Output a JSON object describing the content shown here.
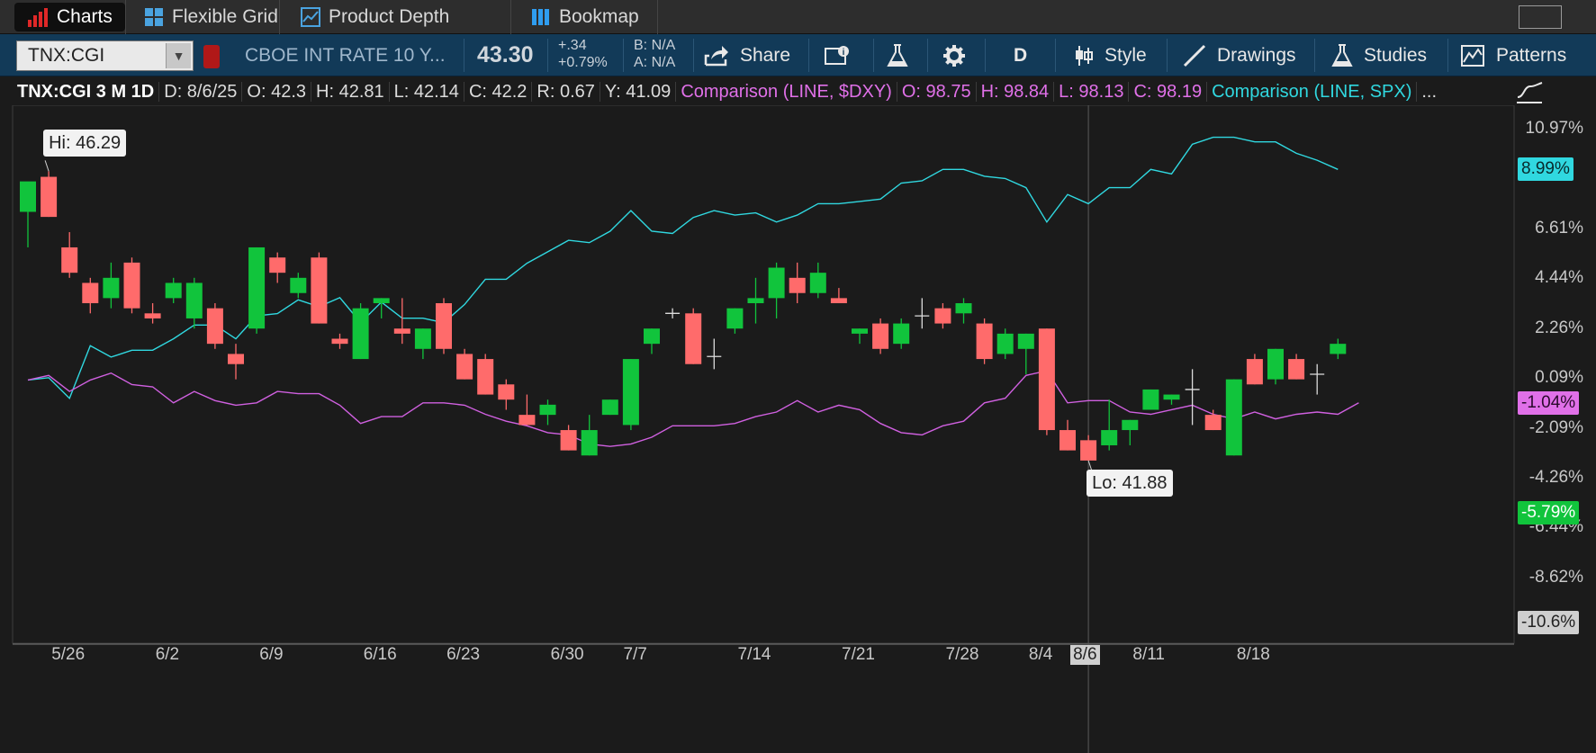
{
  "tabs": [
    {
      "label": "Charts",
      "icon": "bar-chart-icon"
    },
    {
      "label": "Flexible Grid",
      "icon": "grid-icon"
    },
    {
      "label": "Product Depth",
      "icon": "depth-chart-icon"
    },
    {
      "label": "Bookmap",
      "icon": "bookmap-icon"
    }
  ],
  "toolbar": {
    "symbol": "TNX:CGI",
    "description": "CBOE INT RATE 10 Y...",
    "last": "43.30",
    "change": "+.34",
    "change_pct": "+0.79%",
    "bid": "B: N/A",
    "ask": "A: N/A",
    "share": "Share",
    "timeframe": "D",
    "style": "Style",
    "drawings": "Drawings",
    "studies": "Studies",
    "patterns": "Patterns"
  },
  "info": {
    "symbol": "TNX:CGI 3 M 1D",
    "date": "D: 8/6/25",
    "open": "O: 42.3",
    "high": "H: 42.81",
    "low": "L: 42.14",
    "close": "C: 42.2",
    "range": "R: 0.67",
    "prev": "Y: 41.09",
    "cmp1": "Comparison (LINE, $DXY)",
    "cmp1_o": "O: 98.75",
    "cmp1_h": "H: 98.84",
    "cmp1_l": "L: 98.13",
    "cmp1_c": "C: 98.19",
    "cmp2": "Comparison (LINE, SPX)",
    "more": "..."
  },
  "colors": {
    "up": "#11c43c",
    "down": "#ff6b6b",
    "spx": "#30d8e0",
    "dxy": "#d060e0",
    "background": "#1b1b1b"
  },
  "chart_data": {
    "type": "candlestick",
    "ylabel_unit": "%",
    "ylim_pct": [
      -11.5,
      12.0
    ],
    "ylim_price": [
      37.1,
      47.7
    ],
    "right_axis_ticks": [
      "10.97%",
      "6.61%",
      "4.44%",
      "2.26%",
      "0.09%",
      "-2.09%",
      "-4.26%",
      "-6.44%",
      "-8.62%"
    ],
    "x_ticks": [
      "5/26",
      "6/2",
      "6/9",
      "6/16",
      "6/23",
      "6/30",
      "7/7",
      "7/14",
      "7/21",
      "7/28",
      "8/4",
      "8/6",
      "8/11",
      "8/18"
    ],
    "x_tick_positions": [
      2,
      7,
      12,
      17,
      21,
      26,
      29.5,
      35,
      40,
      45,
      49,
      51,
      54,
      59
    ],
    "crosshair_index": 51,
    "hi_label": "Hi: 46.29",
    "lo_label": "Lo: 41.88",
    "tags": {
      "spx": "8.99%",
      "dxy": "-1.04%",
      "last": "-5.79%",
      "bottom": "-10.6%"
    },
    "candles": [
      {
        "o": 45.6,
        "h": 46.1,
        "l": 44.9,
        "c": 46.2
      },
      {
        "o": 46.29,
        "h": 46.4,
        "l": 45.5,
        "c": 45.5
      },
      {
        "o": 44.9,
        "h": 45.2,
        "l": 44.3,
        "c": 44.4
      },
      {
        "o": 44.2,
        "h": 44.3,
        "l": 43.6,
        "c": 43.8
      },
      {
        "o": 43.9,
        "h": 44.6,
        "l": 43.7,
        "c": 44.3
      },
      {
        "o": 44.6,
        "h": 44.7,
        "l": 43.6,
        "c": 43.7
      },
      {
        "o": 43.6,
        "h": 43.8,
        "l": 43.4,
        "c": 43.5
      },
      {
        "o": 43.9,
        "h": 44.3,
        "l": 43.8,
        "c": 44.2
      },
      {
        "o": 43.5,
        "h": 44.3,
        "l": 43.3,
        "c": 44.2
      },
      {
        "o": 43.7,
        "h": 43.8,
        "l": 42.9,
        "c": 43.0
      },
      {
        "o": 42.8,
        "h": 43.0,
        "l": 42.3,
        "c": 42.6
      },
      {
        "o": 43.3,
        "h": 44.9,
        "l": 43.2,
        "c": 44.9
      },
      {
        "o": 44.7,
        "h": 44.8,
        "l": 44.2,
        "c": 44.4
      },
      {
        "o": 44.0,
        "h": 44.4,
        "l": 43.9,
        "c": 44.3
      },
      {
        "o": 44.7,
        "h": 44.8,
        "l": 43.4,
        "c": 43.4
      },
      {
        "o": 43.1,
        "h": 43.2,
        "l": 42.9,
        "c": 43.0
      },
      {
        "o": 42.7,
        "h": 43.8,
        "l": 42.7,
        "c": 43.7
      },
      {
        "o": 43.8,
        "h": 43.9,
        "l": 43.5,
        "c": 43.9
      },
      {
        "o": 43.3,
        "h": 43.9,
        "l": 43.0,
        "c": 43.2
      },
      {
        "o": 42.9,
        "h": 43.3,
        "l": 42.7,
        "c": 43.3
      },
      {
        "o": 43.8,
        "h": 43.9,
        "l": 42.8,
        "c": 42.9
      },
      {
        "o": 42.8,
        "h": 42.9,
        "l": 42.3,
        "c": 42.3
      },
      {
        "o": 42.7,
        "h": 42.8,
        "l": 42.0,
        "c": 42.0
      },
      {
        "o": 42.2,
        "h": 42.3,
        "l": 41.7,
        "c": 41.9
      },
      {
        "o": 41.6,
        "h": 42.0,
        "l": 41.4,
        "c": 41.4
      },
      {
        "o": 41.6,
        "h": 41.9,
        "l": 41.4,
        "c": 41.8
      },
      {
        "o": 41.3,
        "h": 41.4,
        "l": 40.9,
        "c": 40.9
      },
      {
        "o": 40.8,
        "h": 41.6,
        "l": 40.8,
        "c": 41.3
      },
      {
        "o": 41.6,
        "h": 41.9,
        "l": 41.6,
        "c": 41.9
      },
      {
        "o": 41.4,
        "h": 42.7,
        "l": 41.3,
        "c": 42.7
      },
      {
        "o": 43.0,
        "h": 43.3,
        "l": 42.8,
        "c": 43.3
      },
      {
        "o": 43.6,
        "h": 43.7,
        "l": 43.5,
        "c": 43.6
      },
      {
        "o": 43.6,
        "h": 43.7,
        "l": 42.6,
        "c": 42.6
      },
      {
        "o": 42.75,
        "h": 43.1,
        "l": 42.5,
        "c": 42.7
      },
      {
        "o": 43.3,
        "h": 43.7,
        "l": 43.2,
        "c": 43.7
      },
      {
        "o": 43.8,
        "h": 44.3,
        "l": 43.4,
        "c": 43.9
      },
      {
        "o": 43.9,
        "h": 44.6,
        "l": 43.5,
        "c": 44.5
      },
      {
        "o": 44.3,
        "h": 44.6,
        "l": 43.8,
        "c": 44.0
      },
      {
        "o": 44.0,
        "h": 44.6,
        "l": 43.9,
        "c": 44.4
      },
      {
        "o": 43.9,
        "h": 44.1,
        "l": 43.8,
        "c": 43.8
      },
      {
        "o": 43.2,
        "h": 43.3,
        "l": 43.0,
        "c": 43.3
      },
      {
        "o": 43.4,
        "h": 43.5,
        "l": 42.8,
        "c": 42.9
      },
      {
        "o": 43.0,
        "h": 43.5,
        "l": 42.9,
        "c": 43.4
      },
      {
        "o": 43.55,
        "h": 43.9,
        "l": 43.3,
        "c": 43.6
      },
      {
        "o": 43.7,
        "h": 43.8,
        "l": 43.3,
        "c": 43.4
      },
      {
        "o": 43.6,
        "h": 43.9,
        "l": 43.4,
        "c": 43.8
      },
      {
        "o": 43.4,
        "h": 43.5,
        "l": 42.6,
        "c": 42.7
      },
      {
        "o": 42.8,
        "h": 43.3,
        "l": 42.7,
        "c": 43.2
      },
      {
        "o": 42.9,
        "h": 43.2,
        "l": 42.4,
        "c": 43.2
      },
      {
        "o": 43.3,
        "h": 43.3,
        "l": 41.2,
        "c": 41.3
      },
      {
        "o": 41.3,
        "h": 41.5,
        "l": 40.9,
        "c": 40.9
      },
      {
        "o": 41.1,
        "h": 41.2,
        "l": 40.7,
        "c": 40.7
      },
      {
        "o": 41.0,
        "h": 41.9,
        "l": 40.9,
        "c": 41.3
      },
      {
        "o": 41.3,
        "h": 41.5,
        "l": 41.0,
        "c": 41.5
      },
      {
        "o": 41.7,
        "h": 42.1,
        "l": 41.7,
        "c": 42.1
      },
      {
        "o": 41.9,
        "h": 42.0,
        "l": 41.8,
        "c": 42.0
      },
      {
        "o": 42.1,
        "h": 42.5,
        "l": 41.4,
        "c": 42.1
      },
      {
        "o": 41.6,
        "h": 41.7,
        "l": 41.3,
        "c": 41.3
      },
      {
        "o": 40.8,
        "h": 42.3,
        "l": 40.8,
        "c": 42.3
      },
      {
        "o": 42.7,
        "h": 42.8,
        "l": 42.2,
        "c": 42.2
      },
      {
        "o": 42.3,
        "h": 42.9,
        "l": 42.2,
        "c": 42.9
      },
      {
        "o": 42.7,
        "h": 42.8,
        "l": 42.3,
        "c": 42.3
      },
      {
        "o": 42.4,
        "h": 42.6,
        "l": 42.0,
        "c": 42.4
      },
      {
        "o": 42.8,
        "h": 43.1,
        "l": 42.7,
        "c": 43.0
      }
    ],
    "series": [
      {
        "name": "SPX",
        "pct": [
          0.0,
          0.1,
          -0.8,
          1.5,
          1.0,
          1.3,
          1.3,
          1.8,
          2.4,
          2.4,
          1.8,
          2.8,
          2.9,
          3.5,
          3.2,
          3.6,
          2.5,
          3.4,
          2.7,
          2.7,
          2.5,
          3.3,
          4.4,
          4.4,
          5.1,
          5.6,
          6.1,
          6.0,
          6.5,
          7.4,
          6.5,
          6.4,
          7.1,
          7.4,
          7.2,
          7.3,
          6.9,
          7.2,
          7.7,
          7.7,
          7.8,
          7.9,
          8.6,
          8.7,
          9.2,
          9.2,
          8.9,
          8.8,
          8.4,
          6.9,
          8.1,
          7.7,
          8.4,
          8.4,
          9.2,
          9.0,
          10.3,
          10.6,
          10.6,
          10.4,
          10.4,
          9.9,
          9.6,
          9.2
        ]
      },
      {
        "name": "$DXY",
        "pct": [
          0.0,
          0.2,
          -0.5,
          0.0,
          0.3,
          -0.2,
          -0.3,
          -1.0,
          -0.5,
          -0.9,
          -1.1,
          -1.0,
          -0.5,
          -0.6,
          -0.6,
          -1.1,
          -1.9,
          -1.6,
          -1.6,
          -1.0,
          -1.0,
          -1.1,
          -1.5,
          -1.8,
          -2.0,
          -2.3,
          -2.4,
          -2.8,
          -2.9,
          -2.8,
          -2.5,
          -2.0,
          -2.0,
          -2.0,
          -1.9,
          -1.6,
          -1.4,
          -0.9,
          -1.4,
          -1.1,
          -1.3,
          -1.9,
          -2.3,
          -2.4,
          -2.0,
          -1.8,
          -1.0,
          -0.8,
          0.2,
          0.4,
          -1.0,
          -0.9,
          -0.9,
          -1.4,
          -1.5,
          -1.3,
          -1.1,
          -1.5,
          -1.7,
          -1.4,
          -1.7,
          -1.5,
          -1.4,
          -1.5,
          -1.0
        ]
      }
    ]
  }
}
